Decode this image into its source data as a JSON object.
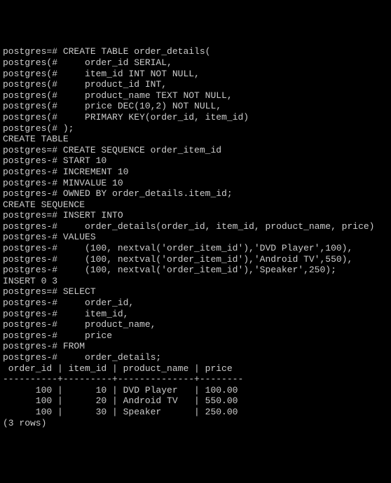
{
  "lines": [
    "postgres=# CREATE TABLE order_details(",
    "postgres(#     order_id SERIAL,",
    "postgres(#     item_id INT NOT NULL,",
    "postgres(#     product_id INT,",
    "postgres(#     product_name TEXT NOT NULL,",
    "postgres(#     price DEC(10,2) NOT NULL,",
    "postgres(#     PRIMARY KEY(order_id, item_id)",
    "postgres(# );",
    "CREATE TABLE",
    "postgres=# CREATE SEQUENCE order_item_id",
    "postgres-# START 10",
    "postgres-# INCREMENT 10",
    "postgres-# MINVALUE 10",
    "postgres-# OWNED BY order_details.item_id;",
    "CREATE SEQUENCE",
    "postgres=# INSERT INTO",
    "postgres-#     order_details(order_id, item_id, product_name, price)",
    "postgres-# VALUES",
    "postgres-#     (100, nextval('order_item_id'),'DVD Player',100),",
    "postgres-#     (100, nextval('order_item_id'),'Android TV',550),",
    "postgres-#     (100, nextval('order_item_id'),'Speaker',250);",
    "INSERT 0 3",
    "postgres=# SELECT",
    "postgres-#     order_id,",
    "postgres-#     item_id,",
    "postgres-#     product_name,",
    "postgres-#     price",
    "postgres-# FROM",
    "postgres-#     order_details;",
    " order_id | item_id | product_name | price",
    "----------+---------+--------------+--------",
    "      100 |      10 | DVD Player   | 100.00",
    "      100 |      20 | Android TV   | 550.00",
    "      100 |      30 | Speaker      | 250.00",
    "(3 rows)"
  ],
  "chart_data": {
    "type": "table",
    "title": "order_details",
    "columns": [
      "order_id",
      "item_id",
      "product_name",
      "price"
    ],
    "rows": [
      [
        100,
        10,
        "DVD Player",
        100.0
      ],
      [
        100,
        20,
        "Android TV",
        550.0
      ],
      [
        100,
        30,
        "Speaker",
        250.0
      ]
    ],
    "row_count_label": "(3 rows)"
  }
}
